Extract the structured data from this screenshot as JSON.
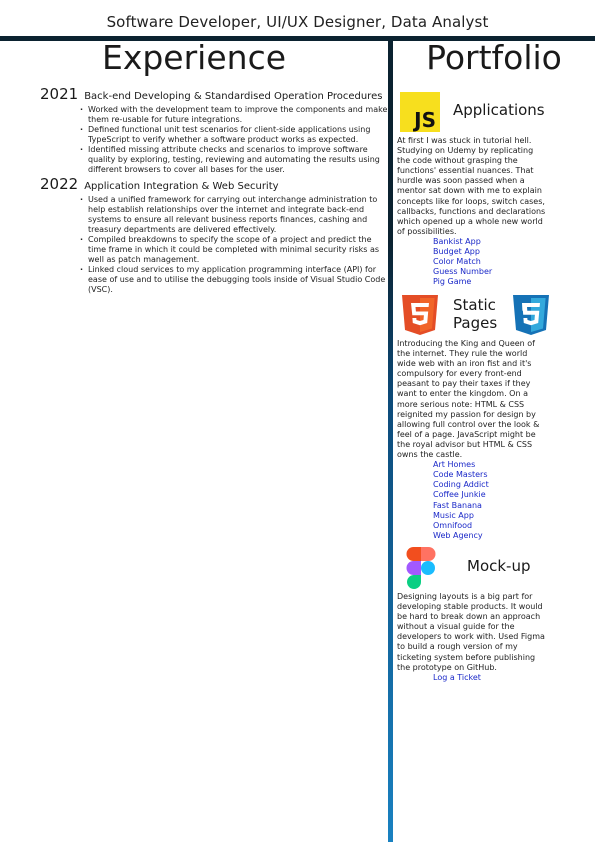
{
  "header": {
    "subtitle": "Software Developer, UI/UX Designer, Data Analyst"
  },
  "experience": {
    "heading": "Experience",
    "entries": [
      {
        "year": "2021",
        "role": "Back-end Developing & Standardised Operation Procedures",
        "bullets": [
          "Worked with the development team to improve the components and make them re-usable for future integrations.",
          "Defined functional unit test scenarios for client-side applications using TypeScript to verify whether a software product works as expected.",
          "Identified missing attribute checks and scenarios to improve software quality by exploring, testing, reviewing and automating the results using different browsers to cover all bases for the user."
        ]
      },
      {
        "year": "2022",
        "role": "Application Integration & Web Security",
        "bullets": [
          "Used a unified framework for carrying out interchange administration to help establish relationships over the internet and integrate back-end systems to ensure all relevant business reports finances, cashing and treasury departments are delivered effectively.",
          "Compiled breakdowns to specify the scope of a project and predict the time frame in which it could be completed with minimal security risks as well as patch management.",
          "Linked cloud services to my application programming interface (API) for ease of use and to utilise the debugging tools inside of Visual Studio Code (VSC)."
        ]
      }
    ]
  },
  "portfolio": {
    "heading": "Portfolio",
    "applications": {
      "title": "Applications",
      "icon_text": "JS",
      "description": "At first I was stuck in tutorial hell. Studying on Udemy by replicating the code without grasping the functions' essential nuances. That hurdle was soon passed when a mentor sat down with me to explain concepts like for loops, switch cases, callbacks, functions and declarations which opened up a whole new world of possibilities.",
      "links": [
        "Bankist App",
        "Budget App",
        "Color Match",
        "Guess Number",
        "Pig Game"
      ]
    },
    "static_pages": {
      "title_line1": "Static",
      "title_line2": "Pages",
      "html_icon_text": "5",
      "css_icon_text": "3",
      "description": "Introducing the King and Queen of the internet. They rule the world wide web with an iron fist and it's compulsory for every front-end peasant to pay their taxes if they want to enter the kingdom. On a more serious note: HTML & CSS reignited my passion for design by allowing full control over the look & feel of a page. JavaScript might be the royal advisor but HTML & CSS owns the castle.",
      "links": [
        "Art Homes",
        "Code Masters",
        "Coding Addict",
        "Coffee Junkie",
        "Fast Banana",
        "Music App",
        "Omnifood",
        "Web Agency"
      ]
    },
    "mockup": {
      "title": "Mock-up",
      "description": "Designing layouts is a big part for developing stable products. It would be hard to break down an approach without a visual guide for the developers to work with. Used Figma to build a rough version of my ticketing system before publishing the prototype on GitHub.",
      "links": [
        "Log a Ticket"
      ]
    }
  },
  "colors": {
    "dark_bar": "#0b2230",
    "divider_blue": "#1a86c7",
    "link": "#1a28c8",
    "js_yellow": "#f7df1e",
    "html_orange": "#e44d26",
    "css_blue": "#1572b6"
  }
}
